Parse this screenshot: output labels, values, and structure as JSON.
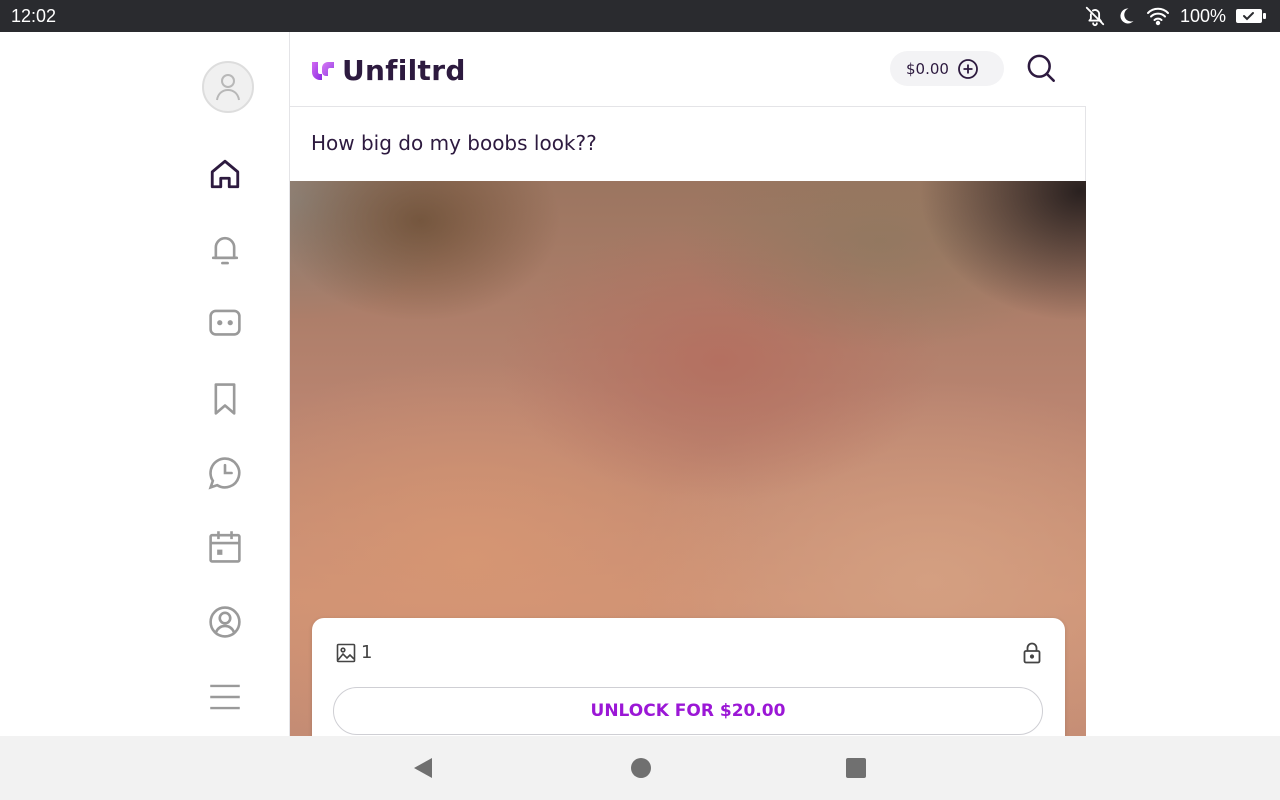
{
  "status_bar": {
    "time": "12:02",
    "battery_percent": "100%",
    "icons": [
      "notifications-off-icon",
      "do-not-disturb-moon-icon",
      "wifi-icon",
      "battery-full-icon"
    ]
  },
  "sidebar": {
    "items": [
      {
        "name": "profile-avatar",
        "icon": "user-avatar-icon"
      },
      {
        "name": "home",
        "icon": "home-icon",
        "active": true
      },
      {
        "name": "notifications",
        "icon": "bell-icon"
      },
      {
        "name": "messages",
        "icon": "chat-icon"
      },
      {
        "name": "bookmarks",
        "icon": "bookmark-icon"
      },
      {
        "name": "history",
        "icon": "clock-chat-icon"
      },
      {
        "name": "calendar",
        "icon": "calendar-icon"
      },
      {
        "name": "account",
        "icon": "user-circle-icon"
      },
      {
        "name": "menu",
        "icon": "hamburger-menu-icon"
      }
    ]
  },
  "header": {
    "brand": "Unfiltrd",
    "balance": "$0.00",
    "brand_color": "#9b17d6"
  },
  "post": {
    "text": "How big do my boobs look??",
    "media_count": "1",
    "unlock_label": "UNLOCK FOR $20.00",
    "locked": true
  },
  "system_nav": {
    "buttons": [
      "back",
      "home",
      "recents"
    ]
  }
}
